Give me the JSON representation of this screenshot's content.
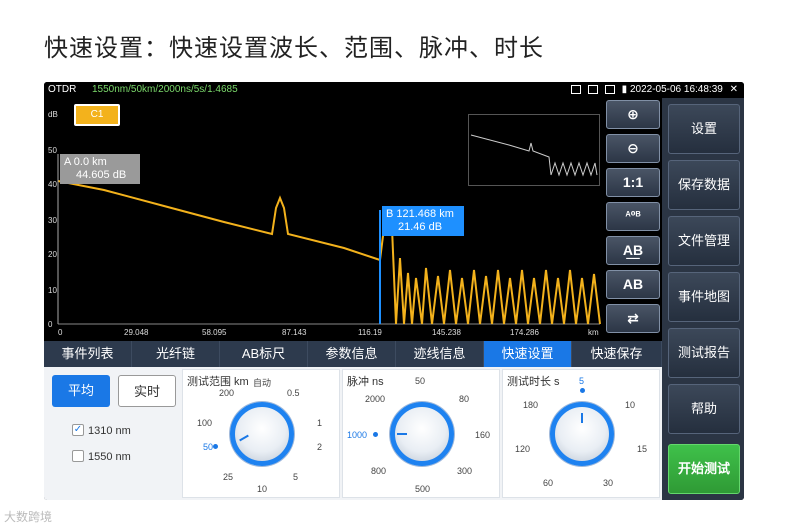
{
  "caption": "快速设置：快速设置波长、范围、脉冲、时长",
  "status": {
    "app": "OTDR",
    "params": "1550nm/50km/2000ns/5s/1.4685",
    "datetime": "2022-05-06 16:48:39"
  },
  "plot": {
    "trace_label": "C1",
    "y_unit": "dB",
    "y_ticks": [
      "50",
      "40",
      "30",
      "20",
      "10",
      "0"
    ],
    "x_ticks": [
      "0",
      "29.048",
      "58.095",
      "87.143",
      "116.19",
      "145.238",
      "174.286"
    ],
    "x_unit": "km",
    "marker_a": {
      "line1": "A 0.0 km",
      "line2": "44.605 dB"
    },
    "marker_b": {
      "line1": "B 121.468 km",
      "line2": "21.46 dB"
    }
  },
  "tools": [
    {
      "name": "zoom-in-icon",
      "glyph": "⊕"
    },
    {
      "name": "zoom-out-icon",
      "glyph": "⊖"
    },
    {
      "name": "reset-zoom-button",
      "glyph": "1:1"
    },
    {
      "name": "marker-ab-icon",
      "glyph": "ᴬ⁰ᴮ"
    },
    {
      "name": "marker-left-ab-icon",
      "glyph": "A͟B"
    },
    {
      "name": "marker-right-ab-icon",
      "glyph": "AB"
    },
    {
      "name": "swap-icon",
      "glyph": "⇄"
    }
  ],
  "sidebar": [
    "设置",
    "保存数据",
    "文件管理",
    "事件地图",
    "测试报告",
    "帮助",
    "开始测试"
  ],
  "tabs": [
    "事件列表",
    "光纤链",
    "AB标尺",
    "参数信息",
    "迹线信息",
    "快速设置",
    "快速保存"
  ],
  "quick": {
    "avg_label": "平均",
    "realtime_label": "实时",
    "wavelengths": [
      {
        "label": "1310 nm",
        "checked": true
      },
      {
        "label": "1550 nm",
        "checked": false
      }
    ],
    "range": {
      "title": "测试范围 km",
      "auto": "自动",
      "values": [
        "0.5",
        "1",
        "2",
        "5",
        "10",
        "25",
        "50",
        "100",
        "200"
      ],
      "selected": "50"
    },
    "pulse": {
      "title": "脉冲 ns",
      "values": [
        "50",
        "80",
        "160",
        "300",
        "500",
        "800",
        "1000",
        "2000"
      ],
      "selected": "1000"
    },
    "duration": {
      "title": "测试时长 s",
      "values": [
        "5",
        "10",
        "15",
        "30",
        "60",
        "120",
        "180"
      ],
      "selected": "5"
    }
  },
  "watermark": "大数跨境",
  "colors": {
    "accent": "#1a78e6",
    "trace": "#f3b21c",
    "start": "#3fc14a"
  }
}
